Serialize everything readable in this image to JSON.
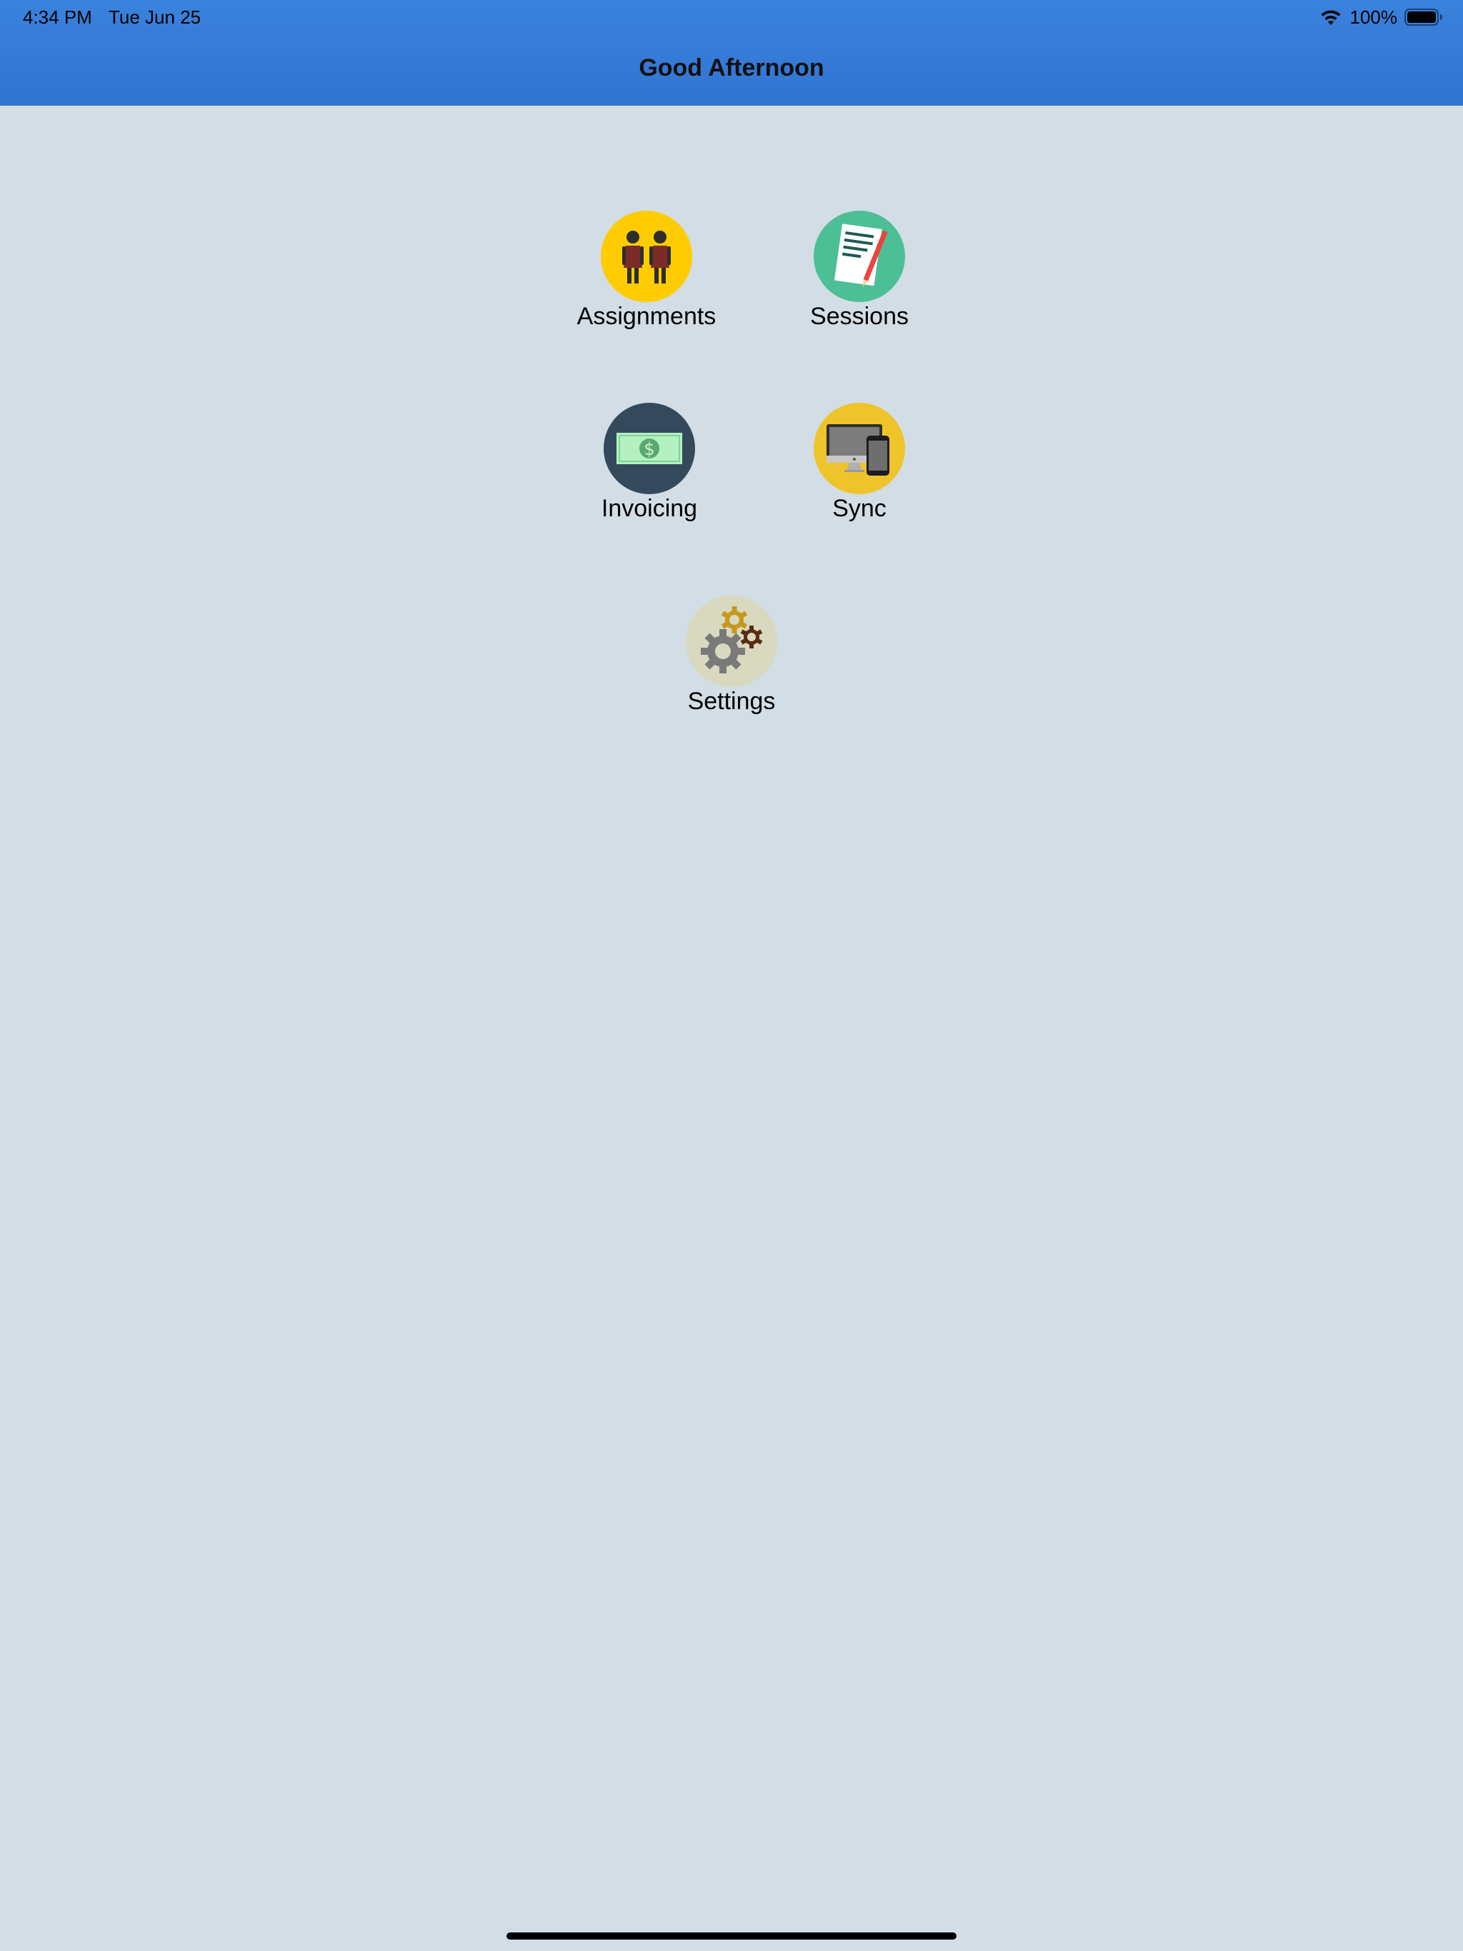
{
  "status_bar": {
    "time": "4:34 PM",
    "date": "Tue Jun 25",
    "battery": "100%",
    "wifi_icon": "wifi-icon",
    "battery_icon": "battery-icon"
  },
  "header": {
    "title": "Good Afternoon",
    "color": "#3a7fd9"
  },
  "menu": {
    "items": [
      {
        "label": "Assignments",
        "icon": "two-people-icon",
        "color": "#fecc00"
      },
      {
        "label": "Sessions",
        "icon": "document-pencil-icon",
        "color": "#4dbf96"
      },
      {
        "label": "Invoicing",
        "icon": "dollar-bill-icon",
        "color": "#344a5c"
      },
      {
        "label": "Sync",
        "icon": "computer-phone-icon",
        "color": "#eec42a"
      },
      {
        "label": "Settings",
        "icon": "gears-icon",
        "color": "#d8d9bf"
      }
    ]
  },
  "background_color": "#d3dde5"
}
